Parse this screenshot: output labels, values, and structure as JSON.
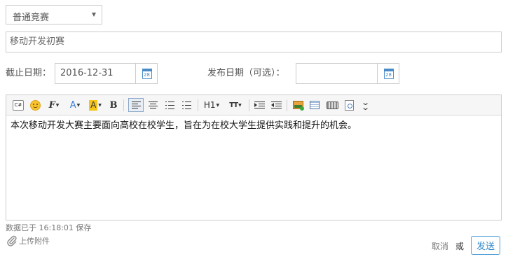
{
  "category": {
    "selected": "普通竞赛"
  },
  "title_field": {
    "value": "移动开发初赛"
  },
  "deadline": {
    "label": "截止日期：",
    "value": "2016-12-31",
    "calendar_day": "28"
  },
  "publish_date": {
    "label": "发布日期（可选）：",
    "value": "",
    "calendar_day": "28"
  },
  "toolbar": {
    "code_label": "C#",
    "font_label": "F",
    "font_color_label": "A",
    "highlight_label": "A",
    "bold_label": "B",
    "heading_label": "H1",
    "font_size_label": "TT"
  },
  "editor": {
    "content": "本次移动开发大赛主要面向高校在校学生，旨在为在校大学生提供实践和提升的机会。"
  },
  "footer": {
    "saved_text": "数据已于 16:18:01 保存",
    "attach_label": "上传附件",
    "cancel_label": "取消",
    "or_label": "或",
    "send_label": "发送"
  },
  "colors": {
    "accent": "#2e86c9",
    "border": "#cccccc",
    "toolbar_bg": "#f6f6f6",
    "highlight": "#f5c518",
    "font_color": "#3b7ed6"
  }
}
